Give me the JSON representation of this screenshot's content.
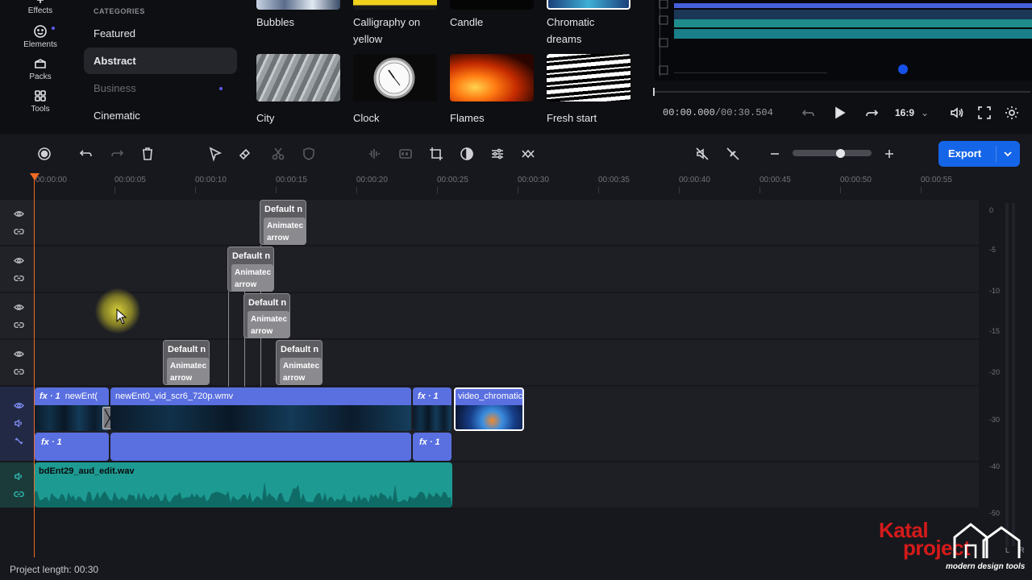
{
  "left_nav": {
    "items": [
      {
        "label": "Effects",
        "icon": "effects-icon"
      },
      {
        "label": "Elements",
        "icon": "smiley-icon"
      },
      {
        "label": "Packs",
        "icon": "packs-icon"
      },
      {
        "label": "Tools",
        "icon": "tools-grid-icon"
      }
    ]
  },
  "categories": {
    "heading": "CATEGORIES",
    "items": [
      {
        "label": "Featured"
      },
      {
        "label": "Abstract"
      },
      {
        "label": "Business"
      },
      {
        "label": "Cinematic"
      }
    ]
  },
  "effects": [
    {
      "label": "Bubbles"
    },
    {
      "label": "Calligraphy on yellow"
    },
    {
      "label": "Candle"
    },
    {
      "label": "Chromatic dreams"
    },
    {
      "label": "City"
    },
    {
      "label": "Clock"
    },
    {
      "label": "Flames"
    },
    {
      "label": "Fresh start"
    }
  ],
  "preview": {
    "timecode_current": "00:00.000",
    "timecode_total": "/00:30.504",
    "aspect_ratio": "16:9"
  },
  "toolbar": {
    "export_label": "Export",
    "export_color": "#1565e8"
  },
  "ruler": {
    "labels": [
      "00:00:00",
      "00:00:05",
      "00:00:10",
      "00:00:15",
      "00:00:20",
      "00:00:25",
      "00:00:30",
      "00:00:35",
      "00:00:40",
      "00:00:45",
      "00:00:50",
      "00:00:55"
    ]
  },
  "text_clips": [
    {
      "title": "Default n",
      "sub": "Animatec arrow"
    },
    {
      "title": "Default n",
      "sub": "Animatec arrow"
    },
    {
      "title": "Default n",
      "sub": "Animatec arrow"
    },
    {
      "title": "Default n",
      "sub": "Animatec arrow"
    },
    {
      "title": "Default n",
      "sub": "Animatec arrow"
    }
  ],
  "video_clips": [
    {
      "fx": "fx · 1",
      "name": "newEnt("
    },
    {
      "fx": "",
      "name": "newEnt0_vid_scr6_720p.wmv"
    },
    {
      "fx": "fx · 1",
      "name": ""
    },
    {
      "fx": "",
      "name": "video_chromatic"
    }
  ],
  "audio_sub_clips": [
    {
      "fx": "fx · 1"
    },
    {
      "fx": ""
    },
    {
      "fx": "fx · 1"
    }
  ],
  "audio_clip": {
    "name": "bdEnt29_aud_edit.wav"
  },
  "meter": {
    "db_labels": [
      "0",
      "-5",
      "-10",
      "-15",
      "-20",
      "-30",
      "-40",
      "-50"
    ],
    "channels": "L R"
  },
  "footer": {
    "project_length": "Project length: 00:30"
  },
  "watermark": {
    "line1": "Katal",
    "line2": "project",
    "tagline": "modern design tools"
  },
  "colors": {
    "accent": "#5a6fe0",
    "audio": "#1d9a92",
    "playhead": "#ee6a24"
  }
}
